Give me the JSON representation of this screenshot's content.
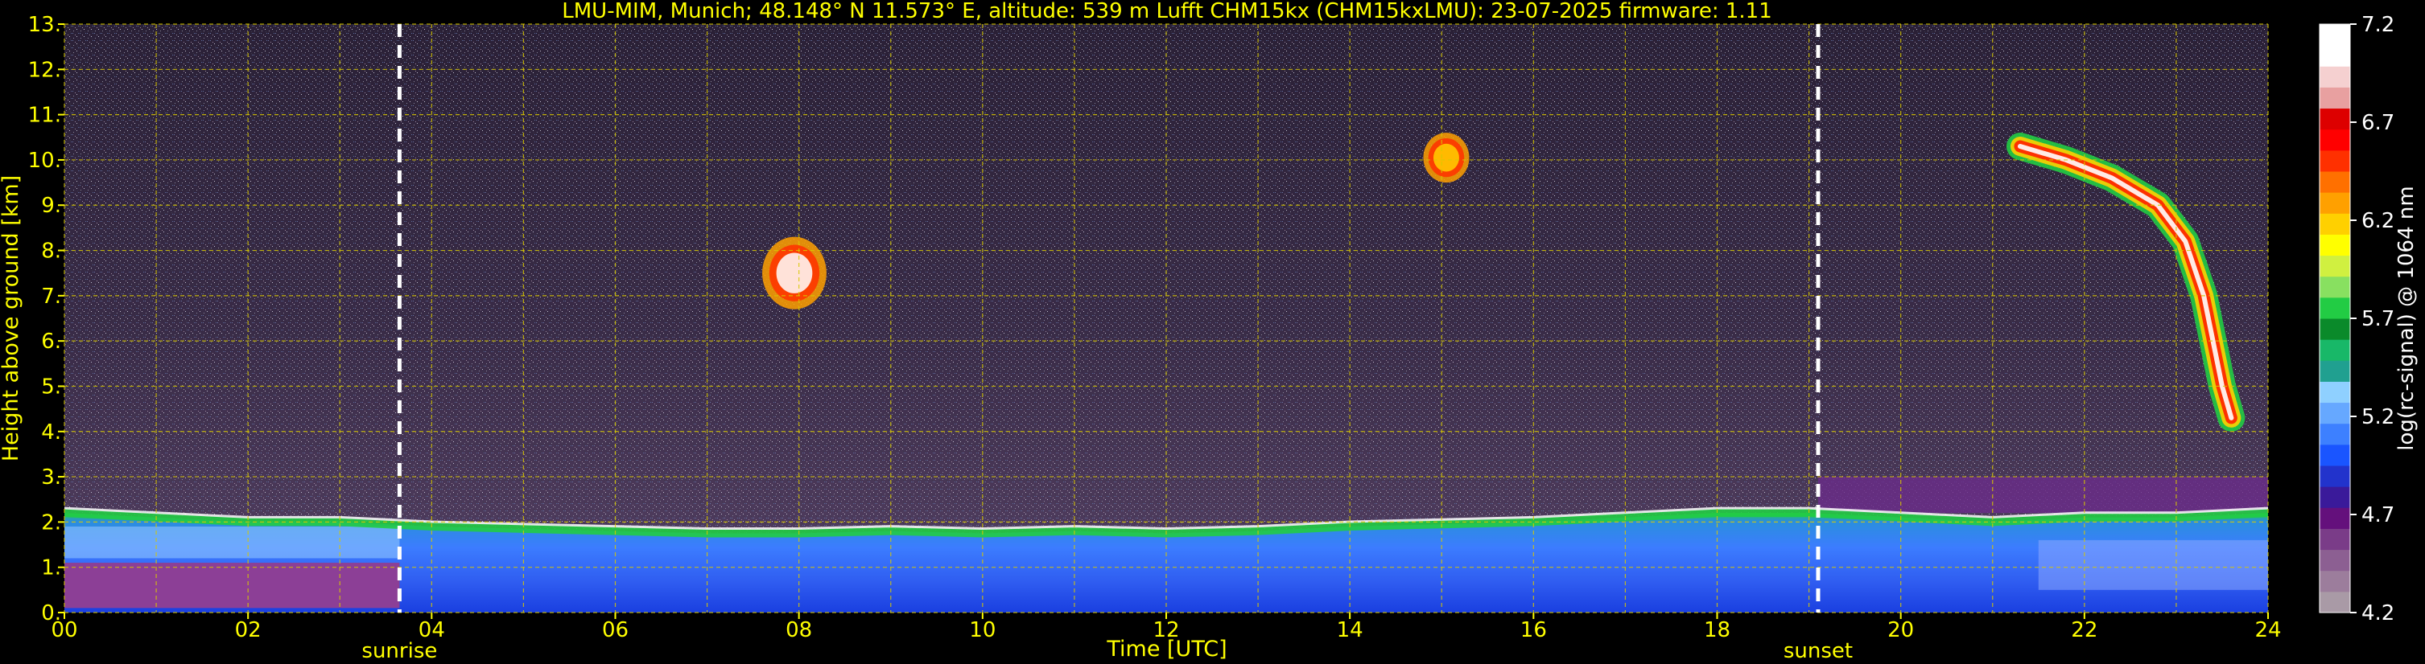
{
  "chart_data": {
    "type": "heatmap",
    "title": "LMU-MIM, Munich; 48.148° N 11.573° E, altitude: 539 m    Lufft CHM15kx (CHM15kxLMU): 23-07-2025    firmware: 1.11",
    "xlabel": "Time [UTC]",
    "ylabel": "Height above ground [km]",
    "colorbar_label": "log(rc-signal) @ 1064 nm",
    "xlim": [
      0,
      24
    ],
    "ylim": [
      0,
      13
    ],
    "x_tick_labels": [
      "00",
      "02",
      "04",
      "06",
      "08",
      "10",
      "12",
      "14",
      "16",
      "18",
      "20",
      "22",
      "24"
    ],
    "y_tick_labels": [
      "0.",
      "1.",
      "2.",
      "3.",
      "4.",
      "5.",
      "6.",
      "7.",
      "8.",
      "9.",
      "10.",
      "11.",
      "12.",
      "13."
    ],
    "grid": true,
    "colorbar": {
      "range": [
        4.2,
        7.2
      ],
      "tick_labels": [
        "4.2",
        "4.7",
        "5.2",
        "5.7",
        "6.2",
        "6.7",
        "7.2"
      ],
      "ticks": [
        4.2,
        4.7,
        5.2,
        5.7,
        6.2,
        6.7,
        7.2
      ],
      "colors": [
        "#a99aa6",
        "#9c7d9c",
        "#8c5f92",
        "#7a3c88",
        "#64107c",
        "#3a1a9a",
        "#2233cc",
        "#1a55ff",
        "#3d80ff",
        "#66a8ff",
        "#8fd0ff",
        "#20a090",
        "#18b868",
        "#0a8a2a",
        "#22cc44",
        "#88e060",
        "#d0f040",
        "#ffff00",
        "#ffd000",
        "#ffa000",
        "#ff7000",
        "#ff3000",
        "#ff0000",
        "#dd0000",
        "#e8a0a0",
        "#f5d0d0",
        "#ffffff",
        "#ffffff"
      ]
    },
    "markers": [
      {
        "label": "sunrise",
        "time": 3.65
      },
      {
        "label": "sunset",
        "time": 19.1
      }
    ],
    "layers": [
      {
        "name": "aerosol-mixed-layer",
        "points": [
          [
            0,
            2.2
          ],
          [
            1,
            2.1
          ],
          [
            2,
            2.0
          ],
          [
            3,
            2.0
          ],
          [
            4,
            1.9
          ],
          [
            5,
            1.85
          ],
          [
            6,
            1.8
          ],
          [
            7,
            1.75
          ],
          [
            8,
            1.75
          ],
          [
            9,
            1.8
          ],
          [
            10,
            1.75
          ],
          [
            11,
            1.8
          ],
          [
            12,
            1.75
          ],
          [
            13,
            1.8
          ],
          [
            14,
            1.9
          ],
          [
            15,
            1.95
          ],
          [
            16,
            2.0
          ],
          [
            17,
            2.1
          ],
          [
            18,
            2.2
          ],
          [
            19,
            2.2
          ],
          [
            20,
            2.1
          ],
          [
            21,
            2.0
          ],
          [
            22,
            2.1
          ],
          [
            23,
            2.1
          ],
          [
            24,
            2.2
          ]
        ]
      },
      {
        "name": "cloud-08utc",
        "time": [
          7.6,
          8.3
        ],
        "height": [
          6.7,
          8.3
        ]
      },
      {
        "name": "cloud-15utc",
        "time": [
          14.8,
          15.3
        ],
        "height": [
          9.5,
          10.6
        ]
      },
      {
        "name": "cirrus-21-24utc",
        "points": [
          [
            21.3,
            10.3
          ],
          [
            21.8,
            10.0
          ],
          [
            22.3,
            9.6
          ],
          [
            22.8,
            9.0
          ],
          [
            23.1,
            8.2
          ],
          [
            23.3,
            7.0
          ],
          [
            23.4,
            6.0
          ],
          [
            23.5,
            5.0
          ],
          [
            23.6,
            4.3
          ]
        ]
      }
    ]
  }
}
